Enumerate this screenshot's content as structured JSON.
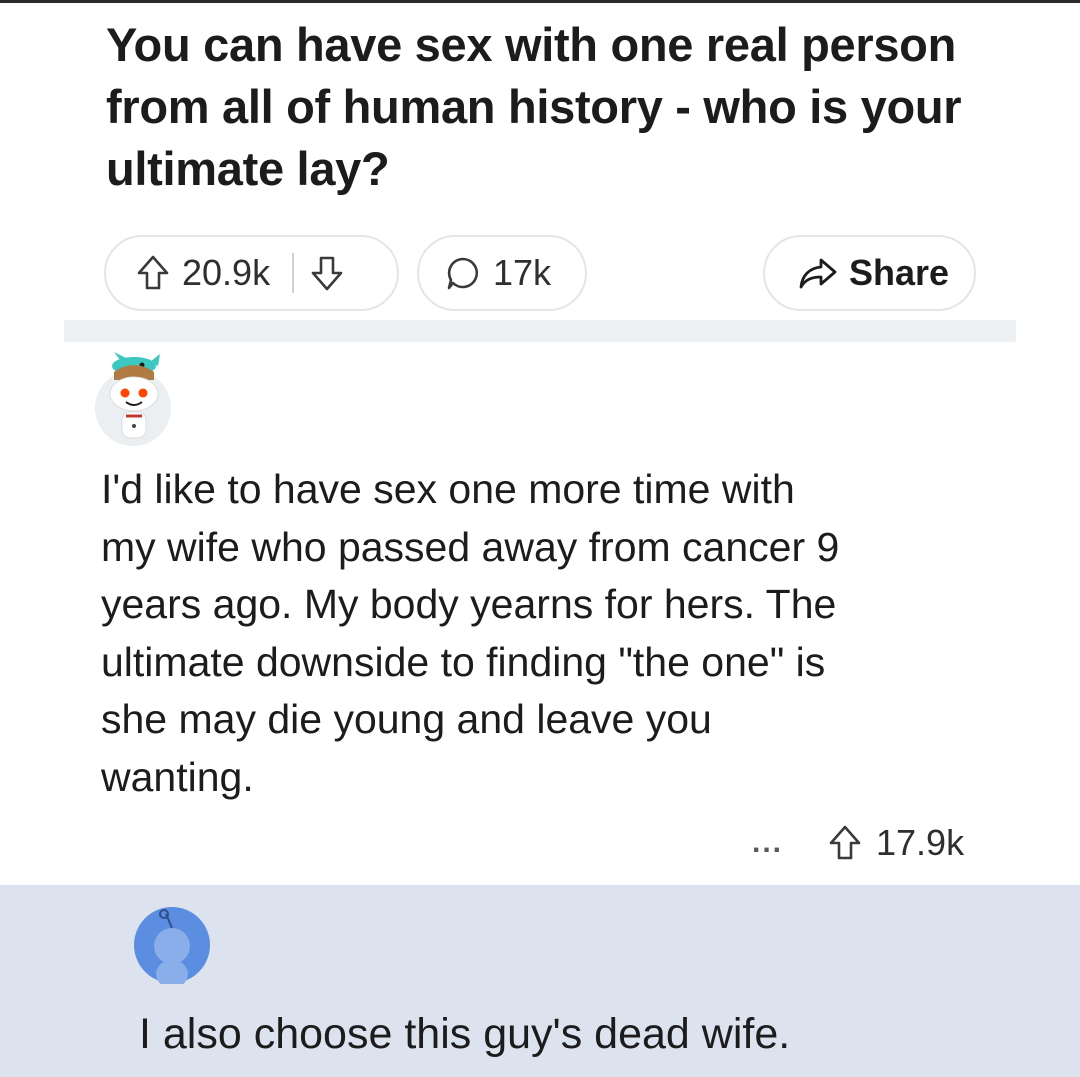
{
  "post": {
    "title": "You can have sex with one real person from all of human history - who is your ultimate lay?",
    "upvotes": "20.9k",
    "comments": "17k",
    "share_label": "Share"
  },
  "comment": {
    "body": "I'd like to have sex one more time with\nmy wife who passed away from cancer 9\nyears ago.  My body yearns for hers.  The\nultimate downside to finding \"the one\" is\nshe may die young and leave you\nwanting.",
    "more_label": "...",
    "upvotes": "17.9k"
  },
  "reply": {
    "body": "I also choose this guy's dead wife."
  },
  "colors": {
    "section_bar": "#eef1f3",
    "reply_background": "#dce3ef",
    "avatar_accent": "#5b8de0"
  },
  "icons": [
    "upvote-icon",
    "downvote-icon",
    "comment-icon",
    "share-icon",
    "avatar-icon"
  ]
}
